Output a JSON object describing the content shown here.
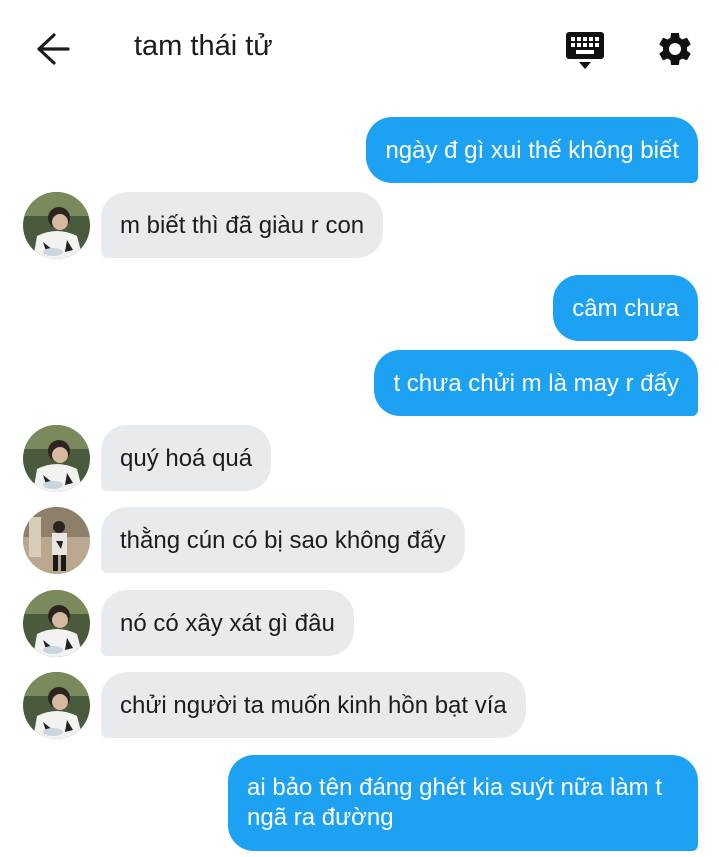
{
  "header": {
    "title": "tam thái tử",
    "back_icon": "arrow-left-icon",
    "keyboard_icon": "keyboard-icon",
    "settings_icon": "gear-icon"
  },
  "colors": {
    "outgoing_bubble": "#1da1f2",
    "incoming_bubble": "#e7ebee",
    "text_dark": "#1c1c1c"
  },
  "messages": [
    {
      "side": "out",
      "text": "ngày đ gì xui thế không biết"
    },
    {
      "side": "in",
      "text": "m biết thì đã giàu r con",
      "avatar": "boy-avatar"
    },
    {
      "side": "out",
      "text": "câm chưa"
    },
    {
      "side": "out",
      "text": "t chưa chửi m là may r đấy"
    },
    {
      "side": "in",
      "text": "quý hoá quá",
      "avatar": "boy-avatar"
    },
    {
      "side": "in",
      "text": "thằng cún có bị sao không đấy",
      "avatar": "man-standing-avatar"
    },
    {
      "side": "in",
      "text": "nó có xây xát gì đâu",
      "avatar": "boy-avatar"
    },
    {
      "side": "in",
      "text": "chửi người ta muốn kinh hồn bạt vía",
      "avatar": "boy-avatar"
    },
    {
      "side": "out",
      "text": "ai bảo tên đáng ghét kia suýt nữa làm t ngã ra đường"
    }
  ]
}
